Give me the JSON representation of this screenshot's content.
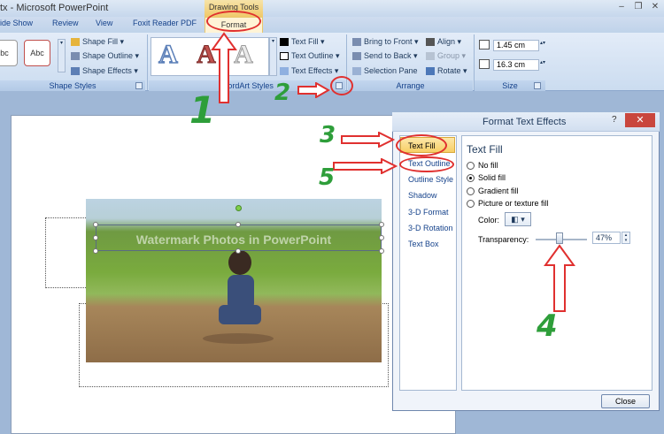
{
  "window": {
    "title": "tx - Microsoft PowerPoint",
    "contextual_tab_group": "Drawing Tools"
  },
  "tabs": [
    "ide Show",
    "Review",
    "View",
    "Foxit Reader PDF",
    "Format"
  ],
  "ribbon": {
    "shape_styles": {
      "label": "Shape Styles",
      "preset_labels": [
        "bc",
        "Abc"
      ],
      "buttons": [
        "Shape Fill",
        "Shape Outline",
        "Shape Effects"
      ]
    },
    "wordart_styles": {
      "label": "WordArt Styles",
      "buttons": [
        "Text Fill",
        "Text Outline",
        "Text Effects"
      ],
      "gallery_letter": "A"
    },
    "arrange": {
      "label": "Arrange",
      "buttons": [
        "Bring to Front",
        "Send to Back",
        "Selection Pane",
        "Align",
        "Group",
        "Rotate"
      ]
    },
    "size": {
      "label": "Size",
      "height": "1.45 cm",
      "width": "16.3 cm"
    }
  },
  "slide": {
    "watermark_text": "Watermark Photos in PowerPoint"
  },
  "annotations": {
    "step1": "1",
    "step2": "2",
    "step3": "3",
    "step4": "4",
    "step5": "5"
  },
  "dialog": {
    "title": "Format Text Effects",
    "help": "?",
    "close_x": "✕",
    "nav": [
      "Text Fill",
      "Text Outline",
      "Outline Style",
      "Shadow",
      "3-D Format",
      "3-D Rotation",
      "Text Box"
    ],
    "section_title": "Text Fill",
    "options": [
      "No fill",
      "Solid fill",
      "Gradient fill",
      "Picture or texture fill"
    ],
    "selected_option": "Solid fill",
    "color_label": "Color:",
    "transparency_label": "Transparency:",
    "transparency_value": "47%",
    "transparency_fraction": 0.47,
    "close_button": "Close"
  },
  "colors": {
    "accent_red": "#e0302f",
    "annotation_green": "#2e9e3a",
    "ribbon_blue": "#cbdcf0"
  }
}
